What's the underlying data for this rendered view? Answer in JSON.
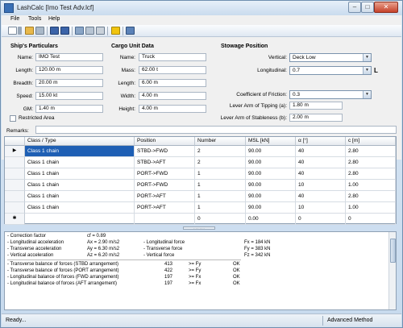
{
  "window": {
    "title": "LashCalc [Imo Test Adv.lcf]",
    "controls": [
      "–",
      "□",
      "✕"
    ]
  },
  "menu": [
    "File",
    "Tools",
    "Help"
  ],
  "ship": {
    "heading": "Ship's Particulars",
    "fields": [
      {
        "label": "Name:",
        "value": "IMO Test"
      },
      {
        "label": "Length:",
        "value": "120.00 m"
      },
      {
        "label": "Breadth:",
        "value": "20.00 m"
      },
      {
        "label": "Speed:",
        "value": "15.00 kt"
      },
      {
        "label": "GM:",
        "value": "1.40 m"
      }
    ],
    "restricted_label": "Restricted Area"
  },
  "cargo": {
    "heading": "Cargo Unit Data",
    "fields": [
      {
        "label": "Name:",
        "value": "Truck"
      },
      {
        "label": "Mass:",
        "value": "62.00 t"
      },
      {
        "label": "Length:",
        "value": "6.00 m"
      },
      {
        "label": "Width:",
        "value": "4.00 m"
      },
      {
        "label": "Height:",
        "value": "4.00 m"
      }
    ]
  },
  "stowage": {
    "heading": "Stowage Position",
    "vertical_label": "Vertical:",
    "vertical_value": "Deck Low",
    "longitudinal_label": "Longitudinal:",
    "longitudinal_value": "0.7",
    "longitudinal_unit": "L",
    "friction_label": "Coefficient of Friction:",
    "friction_value": "0.3",
    "tipping_label": "Lever Arm of Tipping (a):",
    "tipping_value": "1.80 m",
    "stableness_label": "Lever Arm of Stableness (b):",
    "stableness_value": "2.00 m"
  },
  "remarks_label": "Remarks:",
  "grid": {
    "columns": [
      "Class / Type",
      "Position",
      "Number",
      "MSL [kN]",
      "α [°]",
      "c [m]"
    ],
    "rows": [
      [
        "Class 1 chain",
        "STBD->FWD",
        "2",
        "90.00",
        "40",
        "2.80"
      ],
      [
        "Class 1 chain",
        "STBD->AFT",
        "2",
        "90.00",
        "40",
        "2.80"
      ],
      [
        "Class 1 chain",
        "PORT->FWD",
        "1",
        "90.00",
        "40",
        "2.80"
      ],
      [
        "Class 1 chain",
        "PORT->FWD",
        "1",
        "90.00",
        "10",
        "1.00"
      ],
      [
        "Class 1 chain",
        "PORT->AFT",
        "1",
        "90.00",
        "40",
        "2.80"
      ],
      [
        "Class 1 chain",
        "PORT->AFT",
        "1",
        "90.00",
        "10",
        "1.00"
      ]
    ],
    "new_row": [
      "",
      "",
      "0",
      "0.00",
      "0",
      "0"
    ],
    "current_marker": "▶",
    "new_marker": "✱"
  },
  "output": {
    "correction": {
      "label": "- Correction factor",
      "eq": "cf = 0.89"
    },
    "accel_lines": [
      {
        "label": "- Longitudinal acceleration",
        "eq": "Ax = 2.90 m/s2",
        "force_label": "- Longitudinal force",
        "force_eq": "Fx = 184 kN"
      },
      {
        "label": "- Transverse acceleration",
        "eq": "Ay = 6.30 m/s2",
        "force_label": "- Transverse force",
        "force_eq": "Fy = 383 kN"
      },
      {
        "label": "- Vertical acceleration",
        "eq": "Az = 6.20 m/s2",
        "force_label": "- Vertical force",
        "force_eq": "Fz = 342 kN"
      }
    ],
    "balance_lines": [
      {
        "label": "- Transverse balance of forces (STBD arrangement)",
        "val": "413",
        "cmp": ">= Fy",
        "res": "OK"
      },
      {
        "label": "- Transverse balance of forces (PORT arrangement)",
        "val": "422",
        "cmp": ">= Fy",
        "res": "OK"
      },
      {
        "label": "- Longitudinal balance of forces (FWD arrangement)",
        "val": "197",
        "cmp": ">= Fx",
        "res": "OK"
      },
      {
        "label": "- Longitudinal balance of forces (AFT arrangement)",
        "val": "197",
        "cmp": ">= Fx",
        "res": "OK"
      }
    ]
  },
  "status": {
    "left": "Ready...",
    "right": "Advanced Method"
  }
}
